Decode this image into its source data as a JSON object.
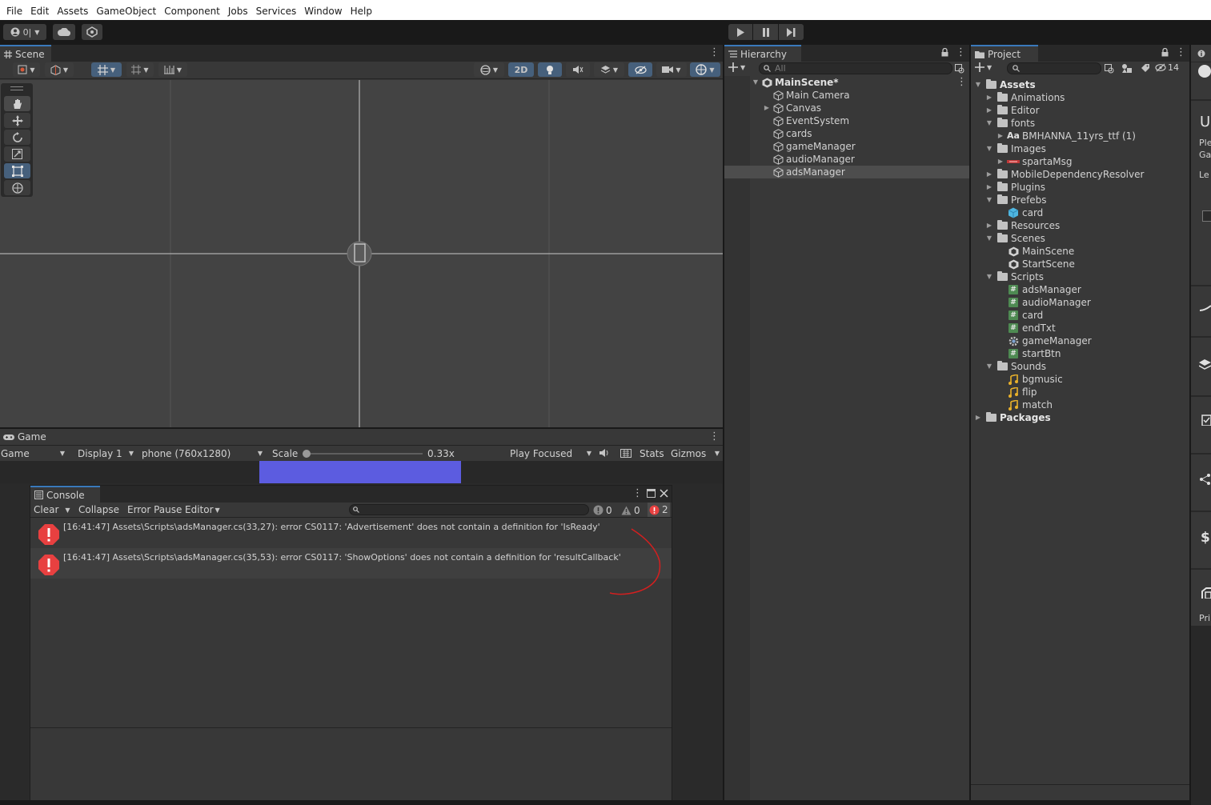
{
  "menu": [
    "File",
    "Edit",
    "Assets",
    "GameObject",
    "Component",
    "Jobs",
    "Services",
    "Window",
    "Help"
  ],
  "toolbar": {
    "account_label": "0|"
  },
  "scene": {
    "tab": "Scene",
    "btn_2d": "2D"
  },
  "game": {
    "tab": "Game",
    "mode": "Game",
    "display": "Display 1",
    "resolution": "phone (760x1280)",
    "scale_label": "Scale",
    "scale_value": "0.33x",
    "scale_fraction": 0.0,
    "play_focused": "Play Focused",
    "stats": "Stats",
    "gizmos": "Gizmos"
  },
  "console": {
    "tab": "Console",
    "clear": "Clear",
    "collapse": "Collapse",
    "error_pause": "Error Pause",
    "editor": "Editor",
    "info_count": "0",
    "warn_count": "0",
    "error_count": "2",
    "errors": [
      "[16:41:47] Assets\\Scripts\\adsManager.cs(33,27): error CS0117: 'Advertisement' does not contain a definition for 'IsReady'",
      "[16:41:47] Assets\\Scripts\\adsManager.cs(35,53): error CS0117: 'ShowOptions' does not contain a definition for 'resultCallback'"
    ]
  },
  "hierarchy": {
    "tab": "Hierarchy",
    "search_placeholder": "All",
    "root": "MainScene*",
    "items": [
      "Main Camera",
      "Canvas",
      "EventSystem",
      "cards",
      "gameManager",
      "audioManager",
      "adsManager"
    ]
  },
  "project": {
    "tab": "Project",
    "hidden_count": "14",
    "tree": [
      {
        "label": "Assets",
        "depth": 0,
        "icon": "folder",
        "expanded": true,
        "bold": true
      },
      {
        "label": "Animations",
        "depth": 1,
        "icon": "folder",
        "expanded": false
      },
      {
        "label": "Editor",
        "depth": 1,
        "icon": "folder",
        "expanded": false
      },
      {
        "label": "fonts",
        "depth": 1,
        "icon": "folder",
        "expanded": true
      },
      {
        "label": "BMHANNA_11yrs_ttf (1)",
        "depth": 2,
        "icon": "font",
        "expanded": false
      },
      {
        "label": "Images",
        "depth": 1,
        "icon": "folder",
        "expanded": true
      },
      {
        "label": "spartaMsg",
        "depth": 2,
        "icon": "sprite",
        "expanded": false
      },
      {
        "label": "MobileDependencyResolver",
        "depth": 1,
        "icon": "folder",
        "expanded": false
      },
      {
        "label": "Plugins",
        "depth": 1,
        "icon": "folder",
        "expanded": false
      },
      {
        "label": "Prefebs",
        "depth": 1,
        "icon": "folder",
        "expanded": true
      },
      {
        "label": "card",
        "depth": 2,
        "icon": "prefab"
      },
      {
        "label": "Resources",
        "depth": 1,
        "icon": "folder",
        "expanded": false
      },
      {
        "label": "Scenes",
        "depth": 1,
        "icon": "folder",
        "expanded": true
      },
      {
        "label": "MainScene",
        "depth": 2,
        "icon": "scene"
      },
      {
        "label": "StartScene",
        "depth": 2,
        "icon": "scene"
      },
      {
        "label": "Scripts",
        "depth": 1,
        "icon": "folder",
        "expanded": true
      },
      {
        "label": "adsManager",
        "depth": 2,
        "icon": "script"
      },
      {
        "label": "audioManager",
        "depth": 2,
        "icon": "script"
      },
      {
        "label": "card",
        "depth": 2,
        "icon": "script"
      },
      {
        "label": "endTxt",
        "depth": 2,
        "icon": "script"
      },
      {
        "label": "gameManager",
        "depth": 2,
        "icon": "gear"
      },
      {
        "label": "startBtn",
        "depth": 2,
        "icon": "script"
      },
      {
        "label": "Sounds",
        "depth": 1,
        "icon": "folder",
        "expanded": true
      },
      {
        "label": "bgmusic",
        "depth": 2,
        "icon": "audio"
      },
      {
        "label": "flip",
        "depth": 2,
        "icon": "audio"
      },
      {
        "label": "match",
        "depth": 2,
        "icon": "audio"
      },
      {
        "label": "Packages",
        "depth": 0,
        "icon": "folder",
        "expanded": false,
        "bold": true
      }
    ]
  },
  "inspector_fragments": {
    "big_letter": "U",
    "line1": "Ple",
    "line2": "Ga",
    "line3": "Le",
    "line4": "Pri"
  },
  "colors": {
    "accent": "#3a79bb",
    "error": "#e84040",
    "annotation": "#d41f1f",
    "game_view": "#5c5ce0"
  }
}
